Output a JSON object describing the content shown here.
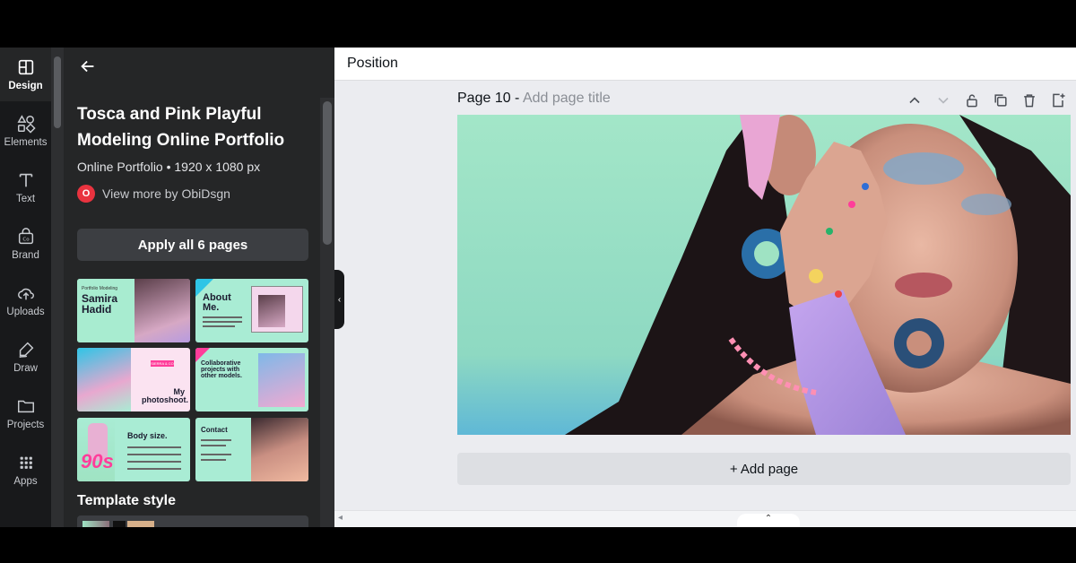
{
  "rail": {
    "items": [
      {
        "label": "Design",
        "icon": "layout-icon",
        "active": true
      },
      {
        "label": "Elements",
        "icon": "shapes-icon"
      },
      {
        "label": "Text",
        "icon": "text-icon"
      },
      {
        "label": "Brand",
        "icon": "brand-icon"
      },
      {
        "label": "Uploads",
        "icon": "cloud-upload-icon"
      },
      {
        "label": "Draw",
        "icon": "pen-icon"
      },
      {
        "label": "Projects",
        "icon": "folder-icon"
      },
      {
        "label": "Apps",
        "icon": "apps-grid-icon"
      }
    ]
  },
  "panel": {
    "template_title": "Tosca and Pink Playful Modeling Online Portfolio",
    "template_meta": "Online Portfolio • 1920 x 1080 px",
    "author_initial": "O",
    "author_link": "View more by ObiDsgn",
    "apply_button": "Apply all 6 pages",
    "thumbnails": [
      {
        "text": "Samira\nHadid",
        "small": "Portfolio Modeling"
      },
      {
        "text": "About\nMe."
      },
      {
        "text": "My\nphotoshoot.",
        "small": "SIERRA & CO"
      },
      {
        "text": "Collaborative\nprojects with\nother models."
      },
      {
        "text": "Body size.",
        "badge": "90s"
      },
      {
        "text": "Contact"
      }
    ],
    "section_title": "Template style"
  },
  "toolbar": {
    "position_label": "Position"
  },
  "canvas": {
    "page_label": "Page 10 -",
    "page_title_placeholder": "Add page title",
    "add_page": "+ Add page"
  },
  "colors": {
    "rail_bg": "#18191b",
    "panel_bg": "#252627",
    "canvas_mint": "#9fe3c3",
    "accent_pink": "#ff3d9a",
    "accent_cyan": "#2ec5e6"
  }
}
